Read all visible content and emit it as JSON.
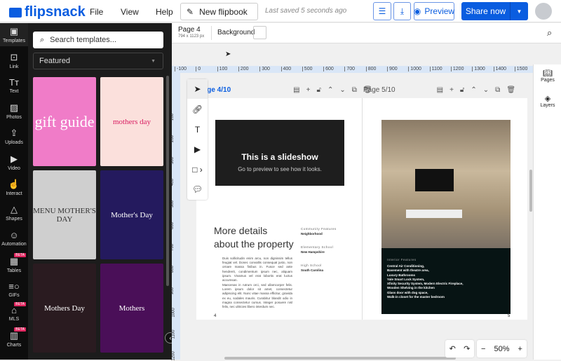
{
  "header": {
    "logo": "flipsnack",
    "menu": [
      "File",
      "View",
      "Help"
    ],
    "flipbook_name": "New flipbook",
    "saved_status": "Last saved 5 seconds ago",
    "preview": "Preview",
    "share": "Share now"
  },
  "rail": [
    {
      "label": "Templates",
      "icon": "▣"
    },
    {
      "label": "Link",
      "icon": "⊡"
    },
    {
      "label": "Text",
      "icon": "Tт"
    },
    {
      "label": "Photos",
      "icon": "▨"
    },
    {
      "label": "Uploads",
      "icon": "⇪"
    },
    {
      "label": "Video",
      "icon": "▶"
    },
    {
      "label": "Interact",
      "icon": "☝"
    },
    {
      "label": "Shapes",
      "icon": "△"
    },
    {
      "label": "Automation",
      "icon": "☺"
    },
    {
      "label": "Tables",
      "icon": "▦",
      "beta": "BETA"
    },
    {
      "label": "GIFs",
      "icon": "≡○"
    },
    {
      "label": "MLS",
      "icon": "⌂",
      "beta": "BETA"
    },
    {
      "label": "Charts",
      "icon": "▥",
      "beta": "BETA"
    }
  ],
  "panel": {
    "search_placeholder": "Search templates...",
    "category": "Featured",
    "templates": [
      {
        "title": "gift guide",
        "bg": "#f07cc8"
      },
      {
        "title": "mothers day",
        "bg": "#fbe0dc"
      },
      {
        "title": "MENU MOTHER'S DAY",
        "bg": "#cfcfcf"
      },
      {
        "title": "Mother's Day",
        "bg": "#241a5e"
      },
      {
        "title": "Mothers Day",
        "bg": "#2a1b20"
      },
      {
        "title": "Mothers",
        "bg": "#4a0f58"
      }
    ]
  },
  "page_bar": {
    "page": "Page 4",
    "size": "794 x 1123 px",
    "background": "Background"
  },
  "ruler_h": [
    "-100",
    "0",
    "100",
    "200",
    "300",
    "400",
    "500",
    "600",
    "700",
    "800",
    "900",
    "1000",
    "1100",
    "1200",
    "1300",
    "1400",
    "1500"
  ],
  "ruler_v": [
    "100",
    "200",
    "300",
    "400",
    "500",
    "600",
    "700",
    "800",
    "900",
    "1000",
    "1100",
    "1200"
  ],
  "right_panel": {
    "pages": "Pages",
    "layers": "Layers"
  },
  "left_page": {
    "label": "Page 4/10",
    "slide_title": "This is a slideshow",
    "slide_sub": "Go to preview to see how it looks.",
    "heading": "More details about the property",
    "para1": "Duis sollicitudin enim arcu, non dignissim tellus feugiat vel. Donec convallis consequat justo, non ornare massa finibus in. Fusce sed ante hendrerit, condimentum ipsum nec, aliquam ipsum. Vivamus vel erat lobortis erat luctus accumsan.",
    "para2": "Maecenas in rutrum orci, sed ullamcorper felis. Lorem ipsum dolor sit amet, consectetur adipiscing elit. Nunc vitae massa efficitur, gravida ex eu, sodales mauris. Curabitur blandit odio in magna consectetur cursus. Integer posuere nisl felis, nec ultricies libero interdum nec.",
    "features": [
      {
        "label": "Community Features",
        "value": "Neighborhood"
      },
      {
        "label": "Elementary School",
        "value": "New Hampshire"
      },
      {
        "label": "High School",
        "value": "South Carolina"
      }
    ],
    "num": "4"
  },
  "right_page": {
    "label": "Page 5/10",
    "interior_label": "Interior Features",
    "interior": [
      "Central Air Conditioning,",
      "Basement with theatre area,",
      "Luxury Bathrooms",
      "Yale Smart Lock System,",
      "Xfinity Security System, Modern Electric Fireplace,",
      "Wooden Shelving in the kitchen",
      "Glass door with dog space,",
      "Walk-in closet for the master bedroom"
    ],
    "num": "5"
  },
  "zoom": {
    "level": "50%"
  },
  "colors": {
    "accent": "#0a5de0",
    "beta": "#e0245e"
  }
}
